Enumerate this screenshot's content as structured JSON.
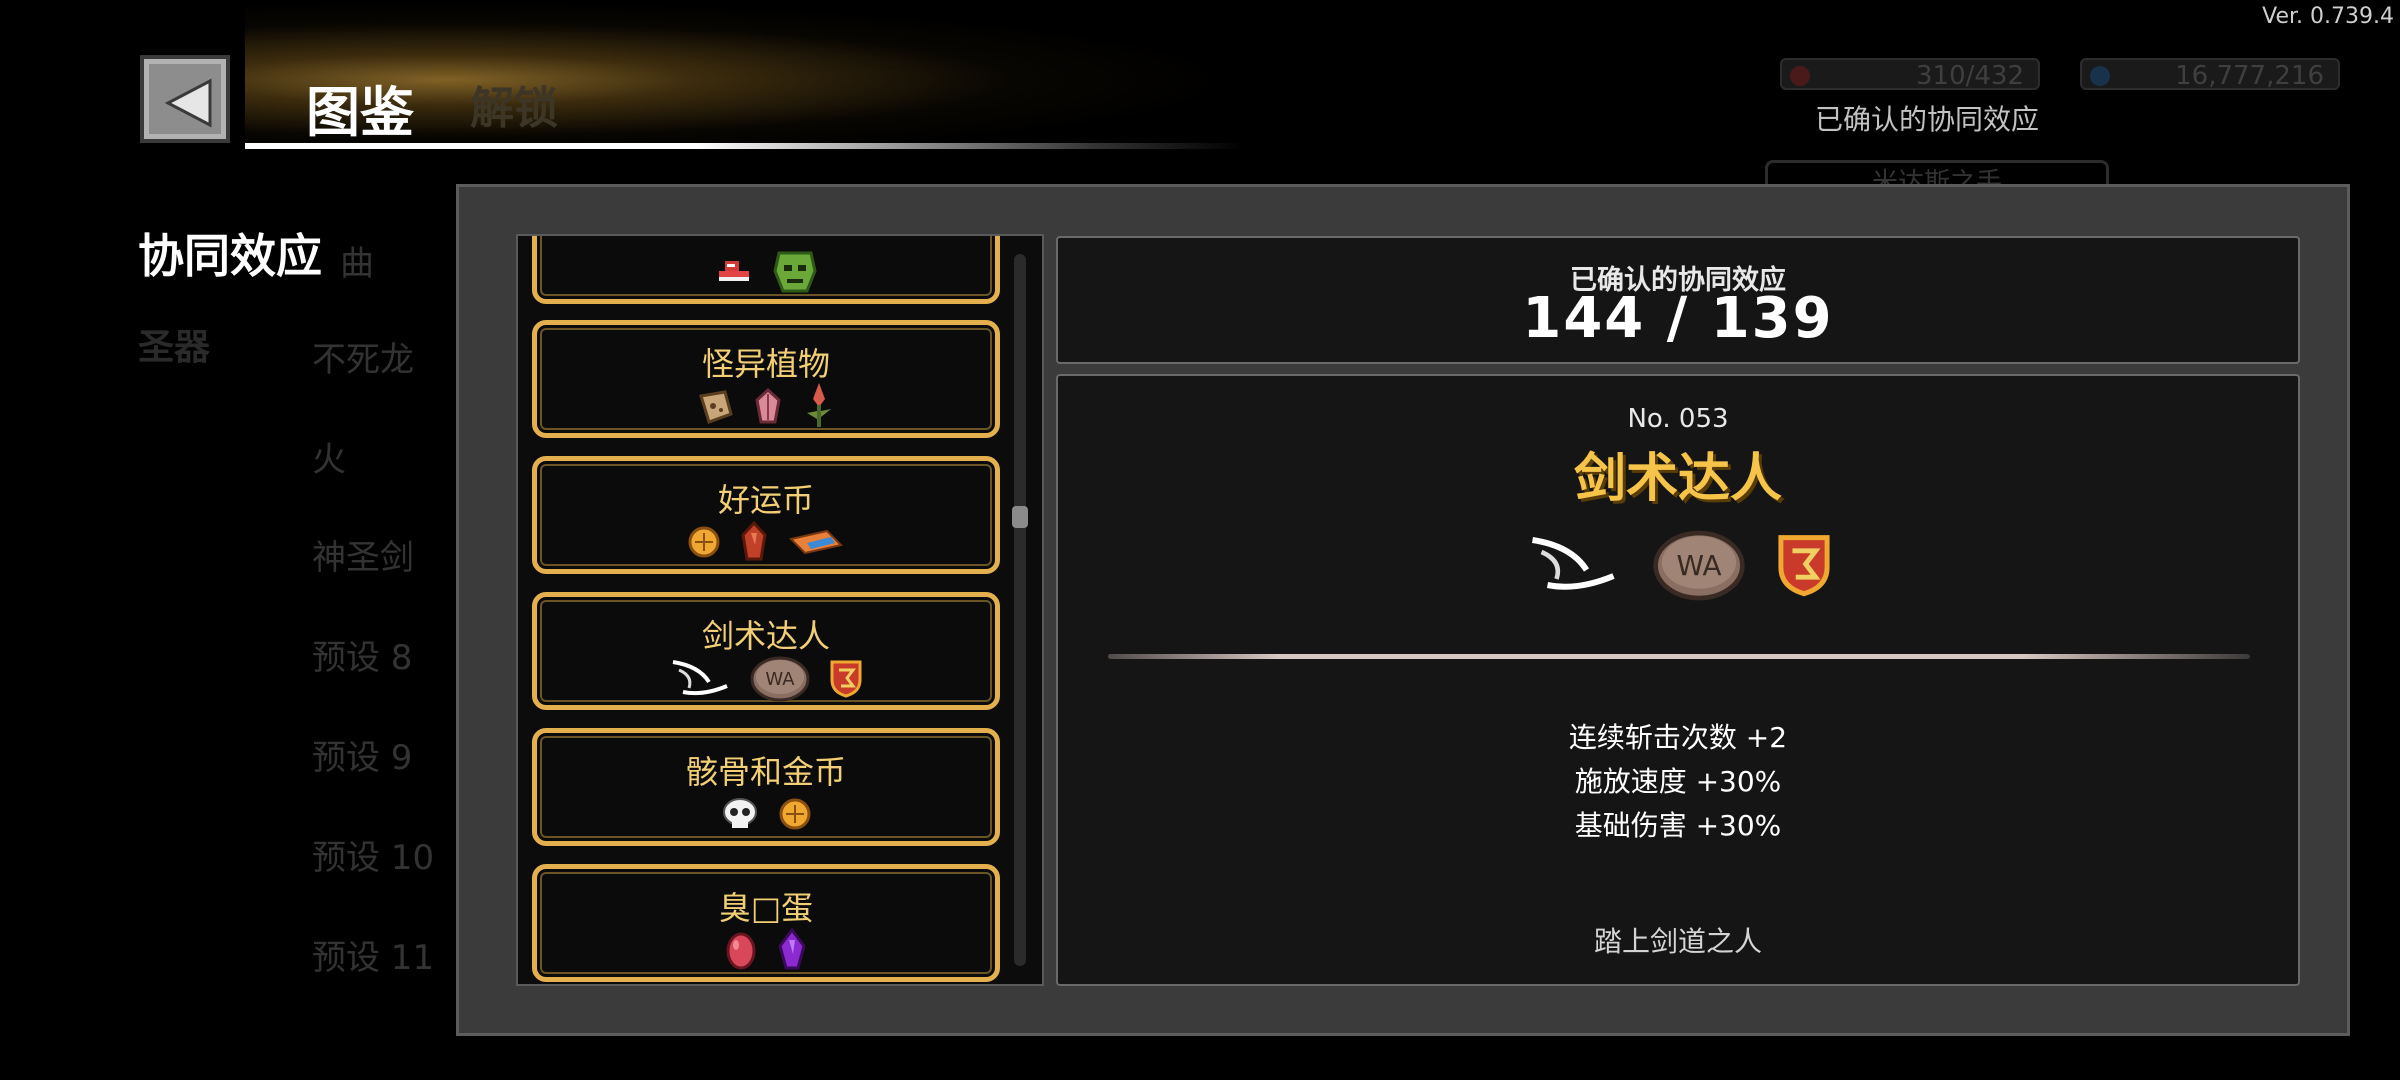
{
  "version": "Ver. 0.739.4",
  "header": {
    "title": "图鉴",
    "bg_tab": "解锁"
  },
  "top_stats": {
    "stat_a": "310/432",
    "stat_b": "16,777,216"
  },
  "background": {
    "confirmed_label": "已确认的协同效应",
    "card_title": "米达斯之手"
  },
  "sidebar": {
    "title": "协同效应",
    "relic": "圣器",
    "sub_items": [
      "曲",
      "不死龙",
      "火",
      "神圣剑",
      "预设 8",
      "预设 9",
      "预设 10",
      "预设 11"
    ]
  },
  "synergy_list": [
    {
      "name": "",
      "icons": [
        "red-sneaker-icon",
        "green-mask-icon"
      ]
    },
    {
      "name": "怪异植物",
      "icons": [
        "seed-pouch-icon",
        "pink-crystal-icon",
        "flower-sprout-icon"
      ]
    },
    {
      "name": "好运币",
      "icons": [
        "gold-coin-icon",
        "red-gem-icon",
        "ticket-icon"
      ]
    },
    {
      "name": "剑术达人",
      "icons": [
        "sword-slash-icon",
        "stone-tablet-icon",
        "crest-shield-icon"
      ]
    },
    {
      "name": "骸骨和金币",
      "icons": [
        "skull-icon",
        "gold-coin-icon"
      ]
    },
    {
      "name": "臭□蛋",
      "icons": [
        "red-egg-icon",
        "purple-gem-icon"
      ]
    }
  ],
  "count_panel": {
    "label": "已确认的协同效应",
    "value": "144 / 139"
  },
  "detail": {
    "number": "No. 053",
    "name": "剑术达人",
    "icons": [
      "sword-slash-icon",
      "stone-tablet-icon",
      "crest-shield-icon"
    ],
    "effects": [
      "连续斩击次数 +2",
      "施放速度 +30%",
      "基础伤害 +30%"
    ],
    "flavor": "踏上剑道之人"
  },
  "colors": {
    "accent_gold": "#f7c44a",
    "card_border": "#e4b04e",
    "modal_bg": "#3b3b3b",
    "panel_bg": "#151515"
  }
}
